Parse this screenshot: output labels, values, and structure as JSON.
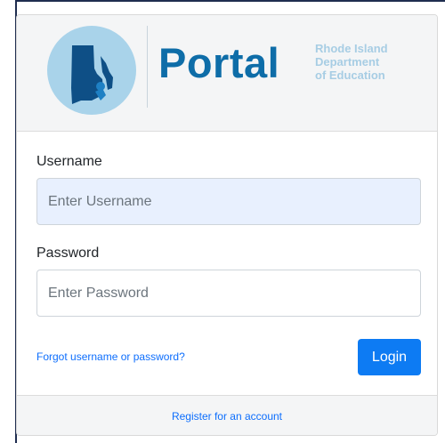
{
  "header": {
    "logo_title": "Portal",
    "org_name_line1": "Rhode Island",
    "org_name_line2": "Department",
    "org_name_line3": "of Education",
    "logo_icon": "rhode-island-map-icon",
    "colors": {
      "brand": "#0e6da8",
      "circle": "#a9d3ea",
      "subtitle": "#a7cde4"
    }
  },
  "form": {
    "username_label": "Username",
    "username_placeholder": "Enter Username",
    "username_value": "",
    "password_label": "Password",
    "password_placeholder": "Enter Password",
    "password_value": "",
    "forgot_link": "Forgot username or password?",
    "login_label": "Login",
    "colors": {
      "primary": "#0d7bf3",
      "link": "#0d6efd"
    }
  },
  "footer": {
    "register_link": "Register for an account"
  }
}
